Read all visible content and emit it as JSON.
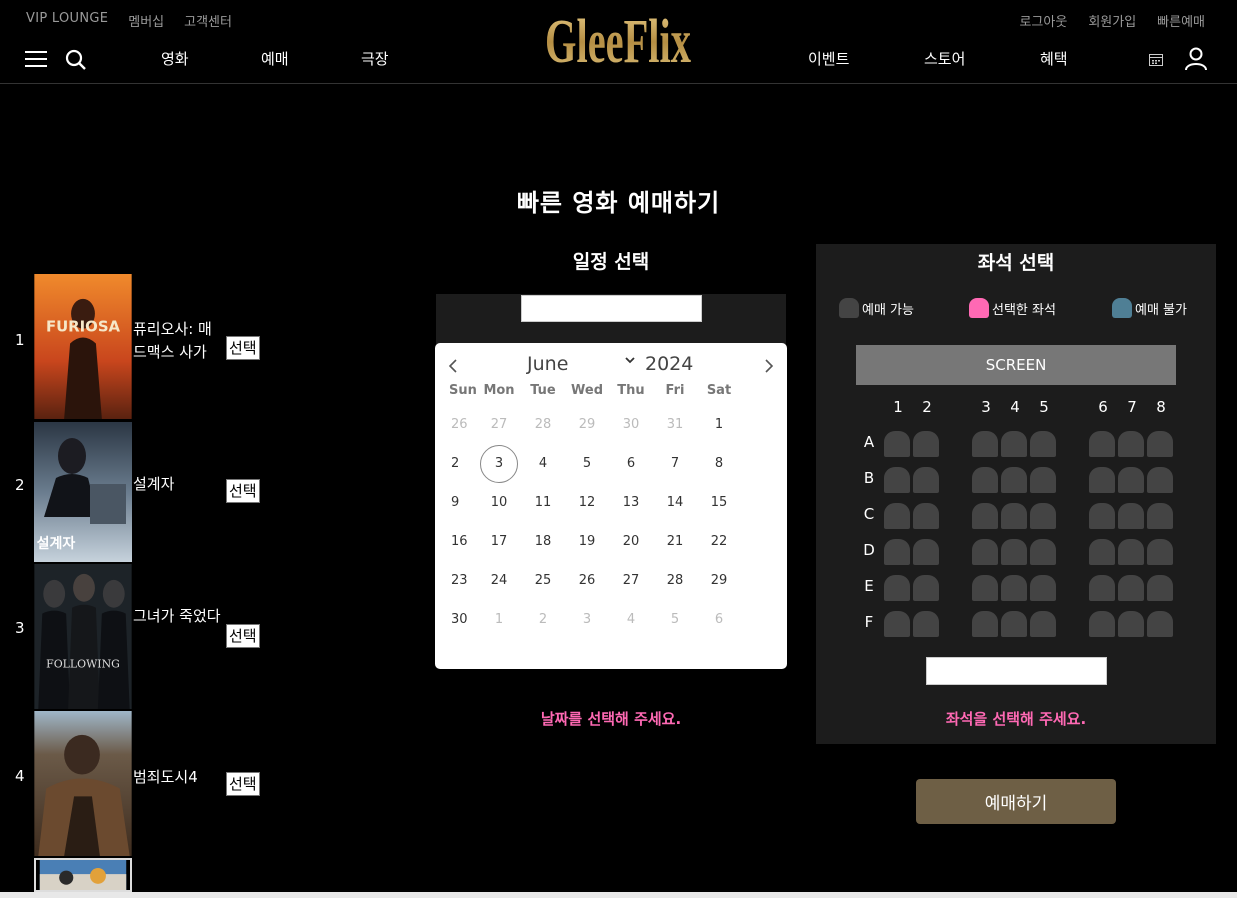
{
  "header": {
    "util_left": [
      "VIP LOUNGE",
      "멤버십",
      "고객센터"
    ],
    "util_right": [
      "로그아웃",
      "회원가입",
      "빠른예매"
    ],
    "logo_text": "GleeFlix",
    "nav_left": [
      "영화",
      "예매",
      "극장"
    ],
    "nav_right": [
      "이벤트",
      "스토어",
      "혜택"
    ]
  },
  "page_title": "빠른 영화 예매하기",
  "movies": [
    {
      "rank": "1",
      "title": "퓨리오사: 매드맥스 사가",
      "select": "선택",
      "poster_text": "FURIOSA"
    },
    {
      "rank": "2",
      "title": "설계자",
      "select": "선택",
      "poster_text": "설계자"
    },
    {
      "rank": "3",
      "title": "그녀가 죽었다",
      "select": "선택",
      "poster_text": "FOLLOWING"
    },
    {
      "rank": "4",
      "title": "범죄도시4",
      "select": "선택",
      "poster_text": ""
    }
  ],
  "schedule": {
    "title": "일정 선택",
    "month": "June",
    "year": "2024",
    "weekdays": [
      "Sun",
      "Mon",
      "Tue",
      "Wed",
      "Thu",
      "Fri",
      "Sat"
    ],
    "weeks": [
      [
        {
          "d": "26",
          "m": true
        },
        {
          "d": "27",
          "m": true
        },
        {
          "d": "28",
          "m": true
        },
        {
          "d": "29",
          "m": true
        },
        {
          "d": "30",
          "m": true
        },
        {
          "d": "31",
          "m": true
        },
        {
          "d": "1"
        }
      ],
      [
        {
          "d": "2"
        },
        {
          "d": "3",
          "today": true
        },
        {
          "d": "4"
        },
        {
          "d": "5"
        },
        {
          "d": "6"
        },
        {
          "d": "7"
        },
        {
          "d": "8"
        }
      ],
      [
        {
          "d": "9"
        },
        {
          "d": "10"
        },
        {
          "d": "11"
        },
        {
          "d": "12"
        },
        {
          "d": "13"
        },
        {
          "d": "14"
        },
        {
          "d": "15"
        }
      ],
      [
        {
          "d": "16"
        },
        {
          "d": "17"
        },
        {
          "d": "18"
        },
        {
          "d": "19"
        },
        {
          "d": "20"
        },
        {
          "d": "21"
        },
        {
          "d": "22"
        }
      ],
      [
        {
          "d": "23"
        },
        {
          "d": "24"
        },
        {
          "d": "25"
        },
        {
          "d": "26"
        },
        {
          "d": "27"
        },
        {
          "d": "28"
        },
        {
          "d": "29"
        }
      ],
      [
        {
          "d": "30"
        },
        {
          "d": "1",
          "m": true
        },
        {
          "d": "2",
          "m": true
        },
        {
          "d": "3",
          "m": true
        },
        {
          "d": "4",
          "m": true
        },
        {
          "d": "5",
          "m": true
        },
        {
          "d": "6",
          "m": true
        }
      ]
    ],
    "message": "날짜를 선택해 주세요."
  },
  "seats": {
    "title": "좌석 선택",
    "legend": [
      {
        "label": "예매 가능",
        "color": "#444444"
      },
      {
        "label": "선택한 좌석",
        "color": "#ff69b4"
      },
      {
        "label": "예매 불가",
        "color": "#4f7f95"
      }
    ],
    "screen": "SCREEN",
    "columns": [
      "1",
      "2",
      "3",
      "4",
      "5",
      "6",
      "7",
      "8"
    ],
    "rows": [
      "A",
      "B",
      "C",
      "D",
      "E",
      "F"
    ],
    "message": "좌석을 선택해 주세요."
  },
  "book_button": "예매하기",
  "colors": {
    "accent": "#ff69b4",
    "book_button": "#6e5f45",
    "logo_gold": "#c9a55a"
  }
}
